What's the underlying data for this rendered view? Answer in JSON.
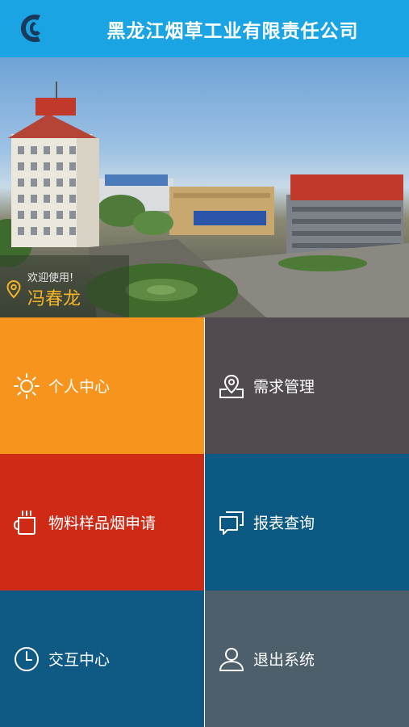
{
  "header": {
    "title": "黑龙江烟草工业有限责任公司"
  },
  "banner": {
    "welcome_text": "欢迎使用!",
    "user_name": "冯春龙"
  },
  "menu": {
    "items": [
      {
        "label": "个人中心",
        "icon": "sun-icon",
        "color": "#f7941d"
      },
      {
        "label": "需求管理",
        "icon": "map-pin-icon",
        "color": "#514a51"
      },
      {
        "label": "物料样品烟申请",
        "icon": "cup-icon",
        "color": "#cf2a16"
      },
      {
        "label": "报表查询",
        "icon": "chat-boxes-icon",
        "color": "#0c5a84"
      },
      {
        "label": "交互中心",
        "icon": "clock-icon",
        "color": "#0f5a85"
      },
      {
        "label": "退出系统",
        "icon": "user-icon",
        "color": "#4d5f6b"
      }
    ]
  }
}
